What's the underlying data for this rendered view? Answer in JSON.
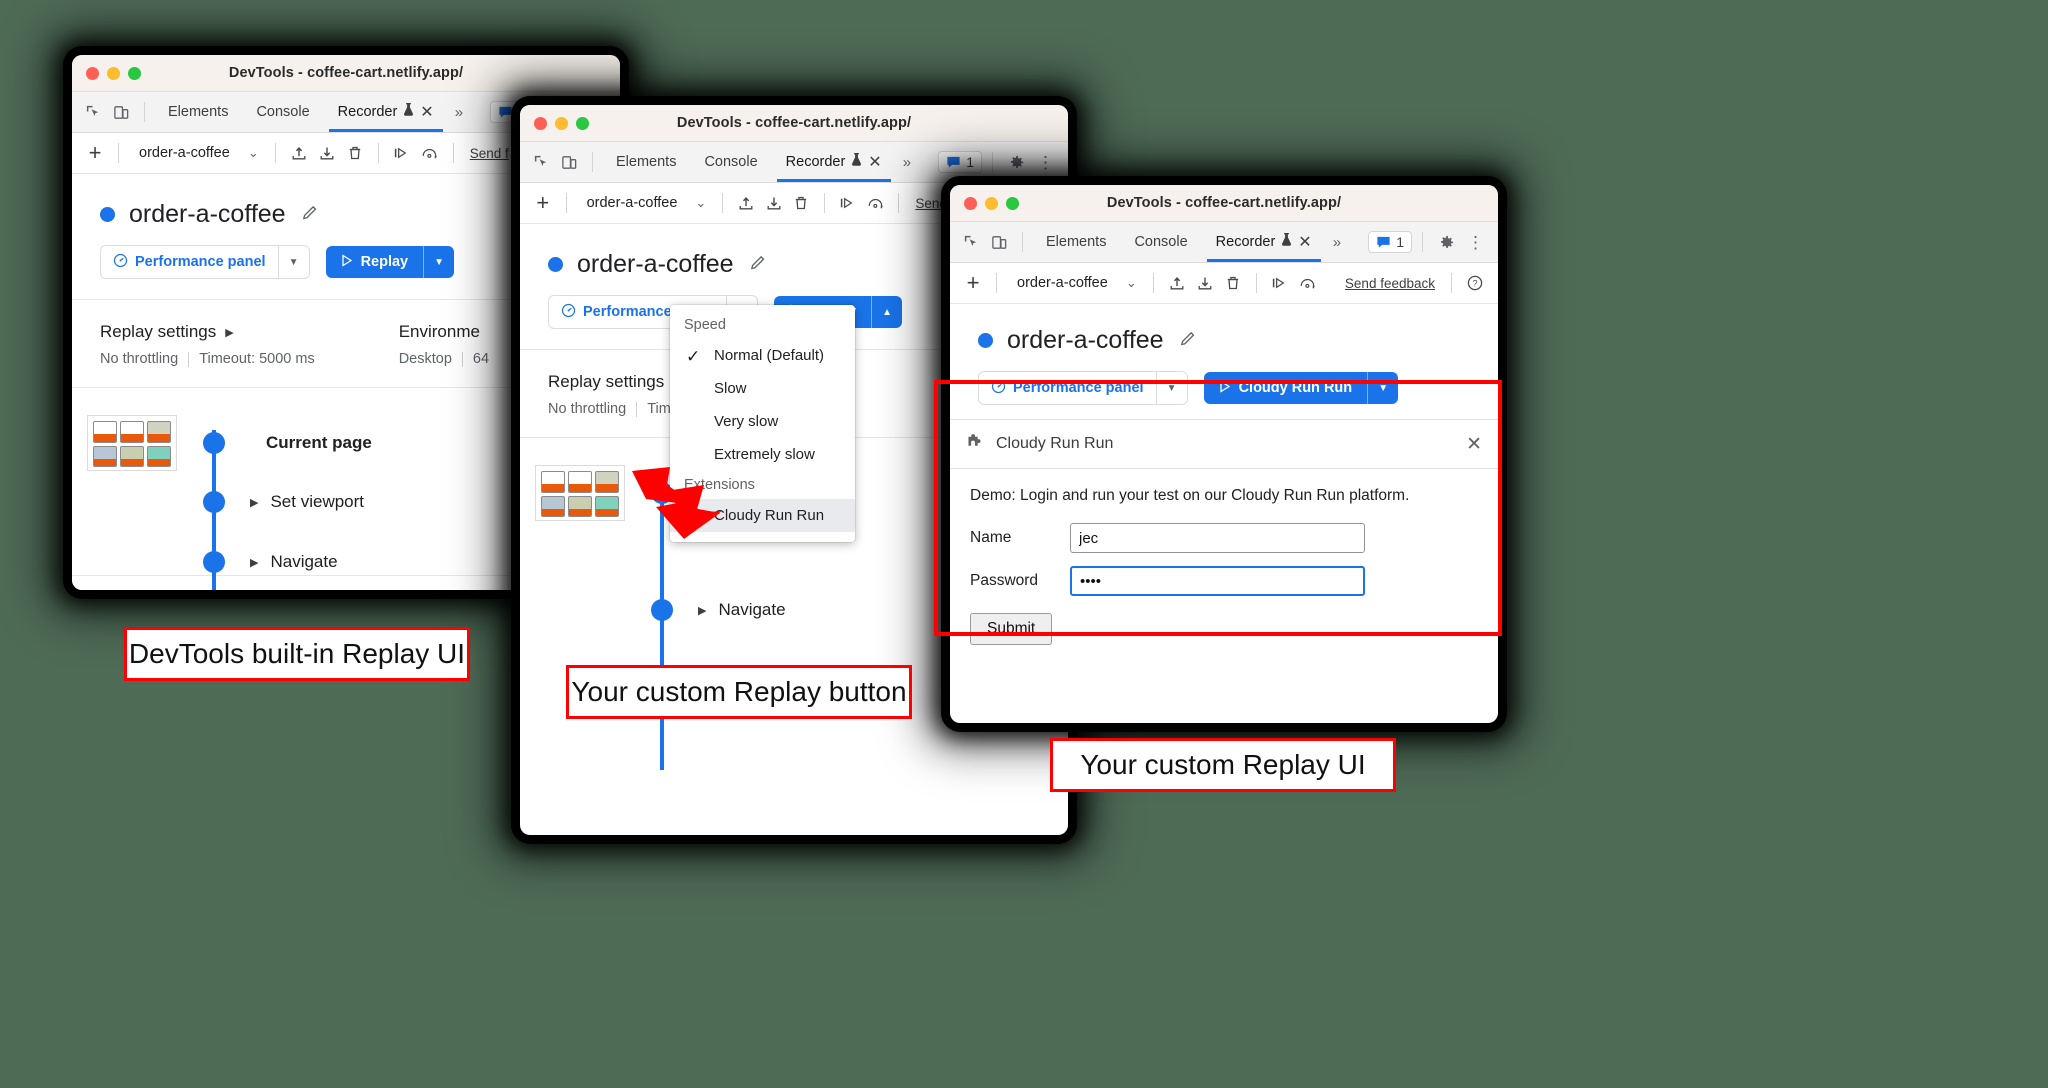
{
  "window_title": "DevTools - coffee-cart.netlify.app/",
  "tabs": {
    "elements": "Elements",
    "console": "Console",
    "recorder": "Recorder",
    "overflow": "»"
  },
  "tab_badges": {
    "issues_count": "1"
  },
  "toolbar": {
    "add_label": "+",
    "recording_name": "order-a-coffee",
    "send_feedback": "Send feedback",
    "send_feedback_truncated": "Send feedback",
    "send_feedback_clipped": "Send f",
    "help": "?"
  },
  "recording": {
    "title": "order-a-coffee",
    "performance_panel_label": "Performance panel",
    "replay_label": "Replay",
    "custom_replay_label": "Cloudy Run Run"
  },
  "replay_settings": {
    "heading": "Replay settings",
    "throttling": "No throttling",
    "timeout": "Timeout: 5000 ms",
    "timeout_clipped": "Tim",
    "heading_clipped": "Replay settings"
  },
  "environment": {
    "heading": "Environment",
    "heading_clipped_w1": "Environme",
    "heading_clipped_w2": "Environm",
    "device": "Desktop",
    "value_clipped": "64"
  },
  "steps": [
    {
      "label": "Current page",
      "bold": true,
      "has_thumbnail": true,
      "has_triangle": false
    },
    {
      "label": "Set viewport",
      "bold": false,
      "has_thumbnail": false,
      "has_triangle": true
    },
    {
      "label": "Navigate",
      "bold": false,
      "has_thumbnail": false,
      "has_triangle": true
    }
  ],
  "steps_win2": [
    {
      "label": "",
      "bold": true,
      "has_thumbnail": true,
      "has_triangle": false
    },
    {
      "label": "Navigate",
      "bold": false,
      "has_thumbnail": false,
      "has_triangle": true
    }
  ],
  "speed_menu": {
    "speed_group_label": "Speed",
    "items": [
      {
        "label": "Normal (Default)",
        "checked": true,
        "highlighted": false
      },
      {
        "label": "Slow",
        "checked": false,
        "highlighted": false
      },
      {
        "label": "Very slow",
        "checked": false,
        "highlighted": false
      },
      {
        "label": "Extremely slow",
        "checked": false,
        "highlighted": false
      }
    ],
    "extensions_group_label": "Extensions",
    "extension_items": [
      {
        "label": "Cloudy Run Run",
        "checked": false,
        "highlighted": true
      }
    ]
  },
  "extension_panel": {
    "name": "Cloudy Run Run",
    "close_label": "✕",
    "demo_text": "Demo: Login and run your test on our Cloudy Run Run platform.",
    "name_label": "Name",
    "name_value": "jec",
    "password_label": "Password",
    "password_value": "••••",
    "submit_label": "Submit"
  },
  "captions": {
    "c1": "DevTools built-in Replay UI",
    "c2": "Your custom Replay button",
    "c3": "Your custom Replay UI"
  },
  "colors": {
    "accent_blue": "#1a73e8",
    "annotation_red": "#ff0000",
    "background_green": "#4e6b56",
    "titlebar": "#f6f1ec",
    "menu_highlight": "#e8eaed"
  }
}
